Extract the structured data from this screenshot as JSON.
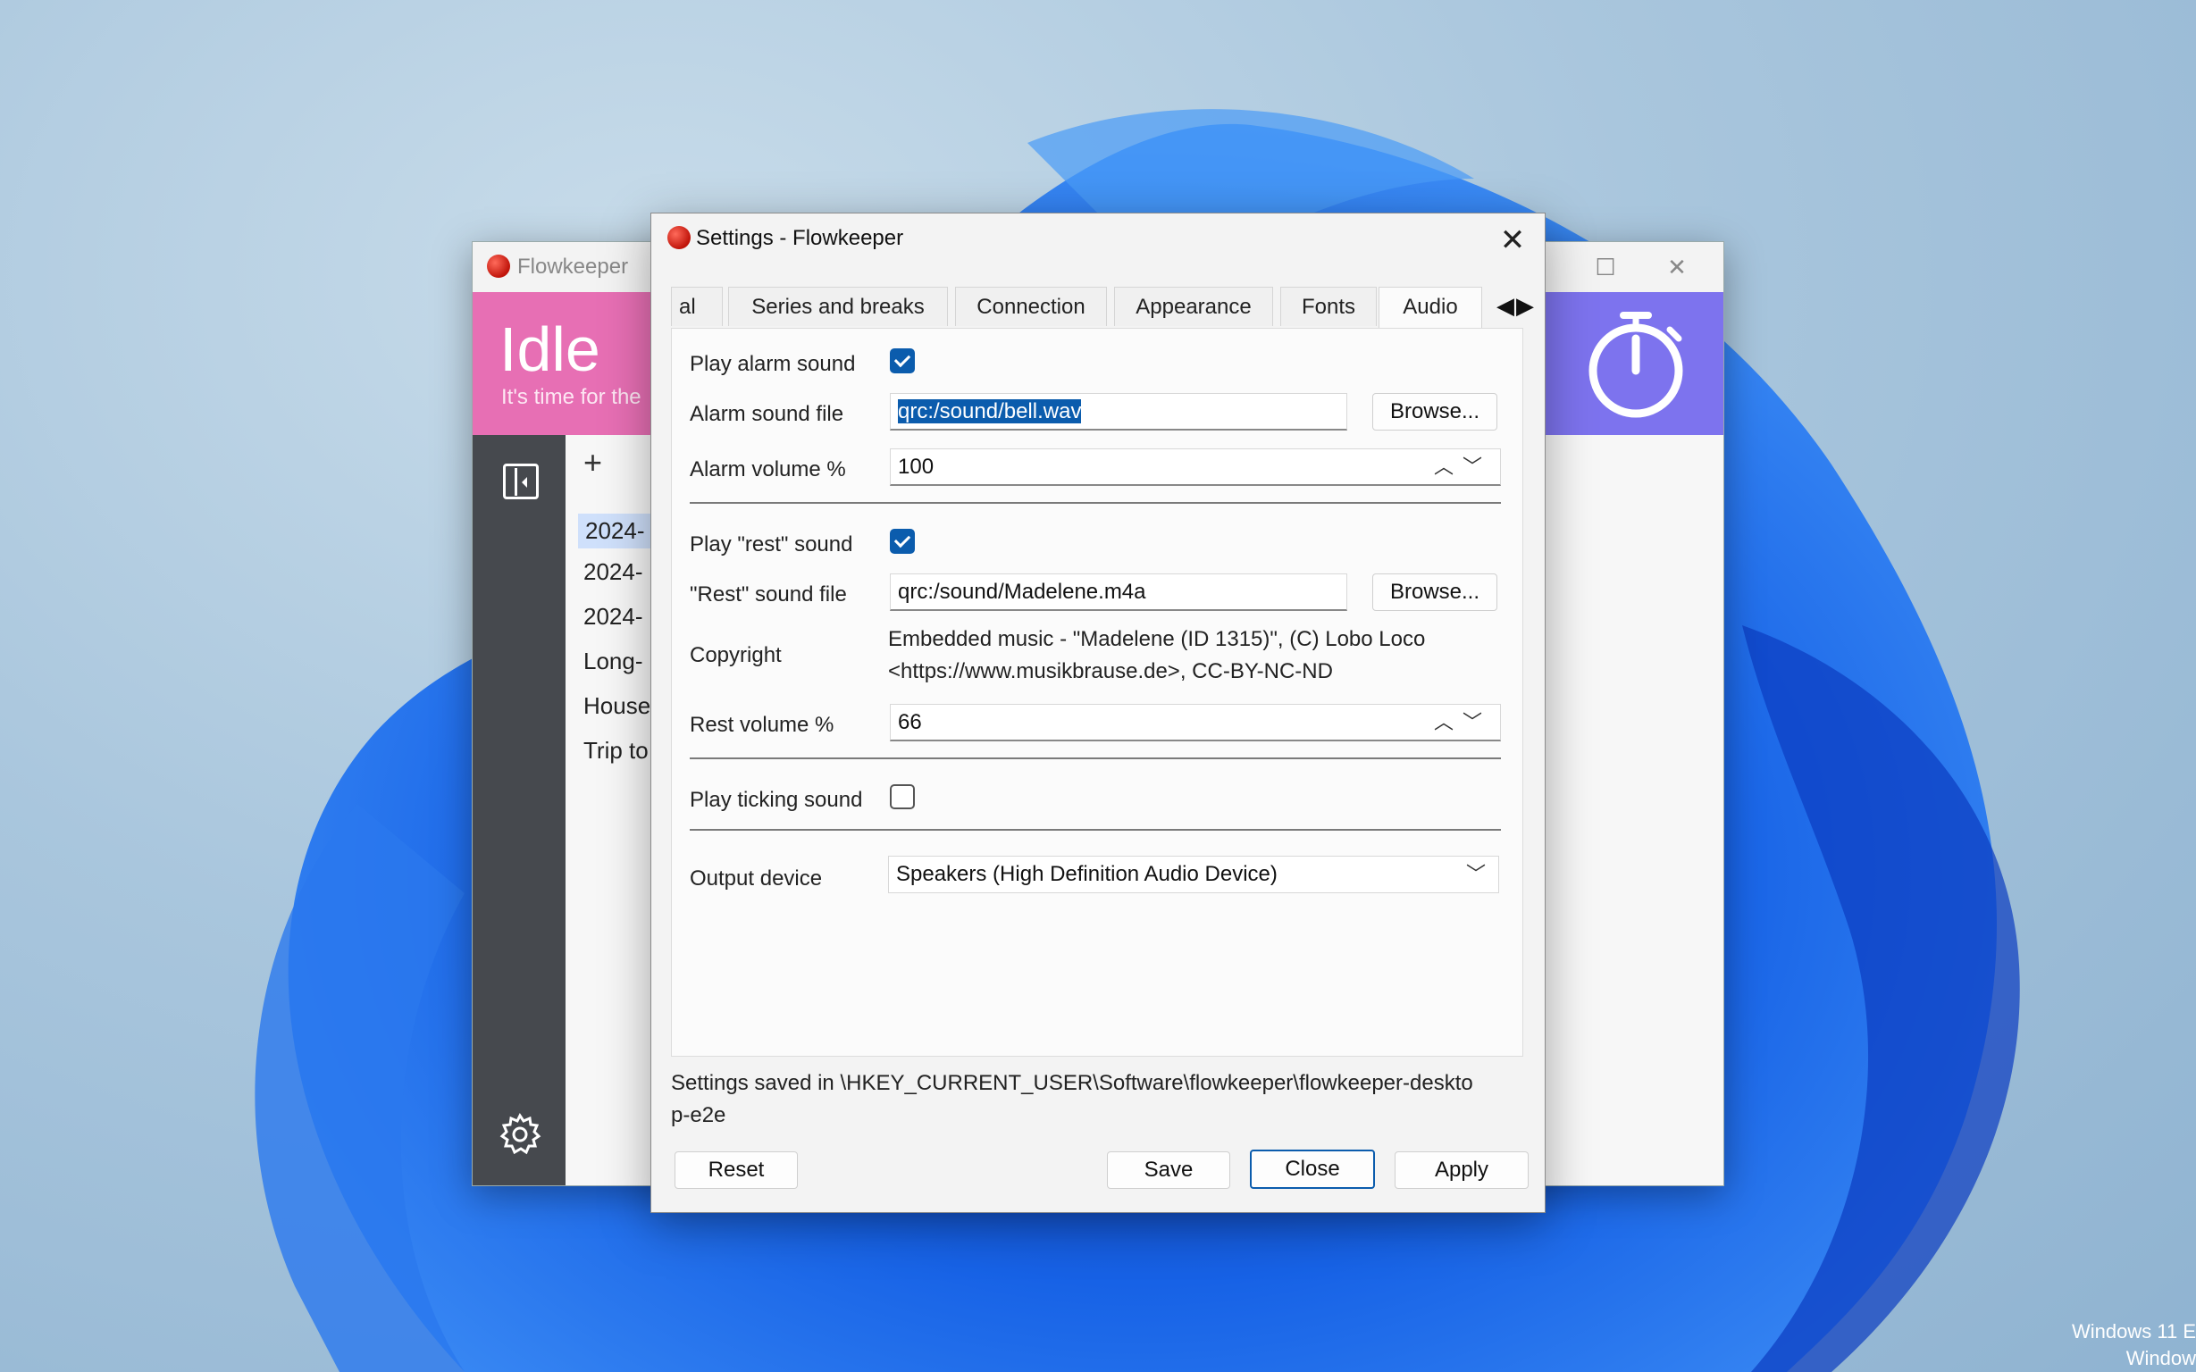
{
  "main_window": {
    "title": "Flowkeeper",
    "header_title": "Idle",
    "header_subtitle": "It's time for the",
    "toolbar_add": "+",
    "list_items": [
      "2024-",
      "2024-",
      "2024-",
      "Long-",
      "House",
      "Trip to"
    ],
    "colors": {
      "header_pink": "#e76fb4",
      "header_purple": "#7d73ee",
      "sidebar": "#46494e"
    }
  },
  "dialog": {
    "title": "Settings - Flowkeeper",
    "tabs": [
      {
        "label": "al"
      },
      {
        "label": "Series and breaks"
      },
      {
        "label": "Connection"
      },
      {
        "label": "Appearance"
      },
      {
        "label": "Fonts"
      },
      {
        "label": "Audio"
      }
    ],
    "active_tab": "Audio",
    "audio": {
      "play_alarm_label": "Play alarm sound",
      "play_alarm_checked": true,
      "alarm_file_label": "Alarm sound file",
      "alarm_file_value": "qrc:/sound/bell.wav",
      "alarm_browse": "Browse...",
      "alarm_volume_label": "Alarm volume %",
      "alarm_volume_value": "100",
      "play_rest_label": "Play \"rest\" sound",
      "play_rest_checked": true,
      "rest_file_label": "\"Rest\" sound file",
      "rest_file_value": "qrc:/sound/Madelene.m4a",
      "rest_browse": "Browse...",
      "copyright_label": "Copyright",
      "copyright_line1": "Embedded music - \"Madelene (ID 1315)\", (C) Lobo Loco",
      "copyright_line2": "<https://www.musikbrause.de>, CC-BY-NC-ND",
      "rest_volume_label": "Rest volume %",
      "rest_volume_value": "66",
      "play_ticking_label": "Play ticking sound",
      "play_ticking_checked": false,
      "output_device_label": "Output device",
      "output_device_value": "Speakers (High Definition Audio Device)"
    },
    "saved_text": "Settings saved in \\HKEY_CURRENT_USER\\Software\\flowkeeper\\flowkeeper-desktop-e2e",
    "buttons": {
      "reset": "Reset",
      "save": "Save",
      "close": "Close",
      "apply": "Apply"
    },
    "accent_color": "#0b5cad"
  },
  "desktop": {
    "watermark_line1": "Windows 11 E",
    "watermark_line2": "Window"
  }
}
